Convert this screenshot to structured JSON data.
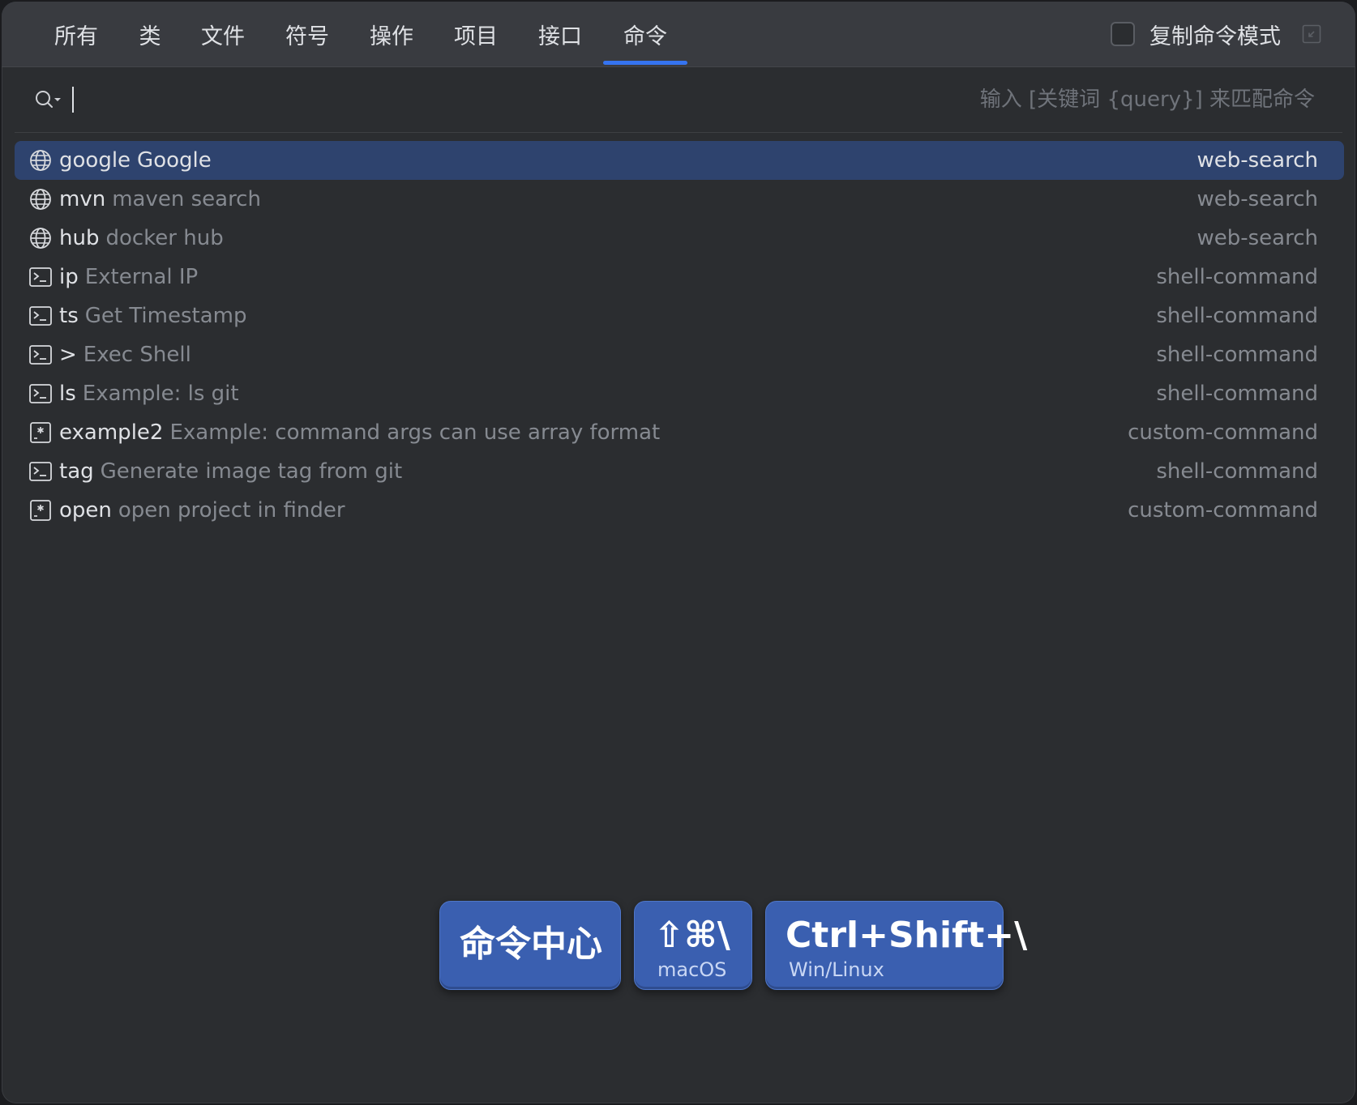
{
  "tabs": [
    {
      "label": "所有"
    },
    {
      "label": "类"
    },
    {
      "label": "文件"
    },
    {
      "label": "符号"
    },
    {
      "label": "操作"
    },
    {
      "label": "项目"
    },
    {
      "label": "接口"
    },
    {
      "label": "命令"
    }
  ],
  "active_tab": "命令",
  "copy_mode": {
    "label": "复制命令模式",
    "checked": false
  },
  "search": {
    "value": "",
    "placeholder": "输入 [关键词 {query}] 来匹配命令"
  },
  "results": [
    {
      "name": "google",
      "desc": "Google",
      "type": "web-search",
      "icon": "globe-icon",
      "selected": true
    },
    {
      "name": "mvn",
      "desc": "maven search",
      "type": "web-search",
      "icon": "globe-icon"
    },
    {
      "name": "hub",
      "desc": "docker hub",
      "type": "web-search",
      "icon": "globe-icon"
    },
    {
      "name": "ip",
      "desc": "External IP",
      "type": "shell-command",
      "icon": "terminal-icon"
    },
    {
      "name": "ts",
      "desc": "Get Timestamp",
      "type": "shell-command",
      "icon": "terminal-icon"
    },
    {
      "name": ">",
      "desc": "Exec Shell",
      "type": "shell-command",
      "icon": "terminal-icon"
    },
    {
      "name": "ls",
      "desc": "Example: ls git",
      "type": "shell-command",
      "icon": "terminal-icon"
    },
    {
      "name": "example2",
      "desc": "Example: command args can use array format",
      "type": "custom-command",
      "icon": "custom-command-icon"
    },
    {
      "name": "tag",
      "desc": "Generate image tag from git",
      "type": "shell-command",
      "icon": "terminal-icon"
    },
    {
      "name": "open",
      "desc": "open project in finder",
      "type": "custom-command",
      "icon": "custom-command-icon"
    }
  ],
  "shortcut_badges": {
    "title": "命令中心",
    "mac": {
      "keys": "⇧⌘\\",
      "os": "macOS"
    },
    "win": {
      "keys": "Ctrl+Shift+\\",
      "os": "Win/Linux"
    }
  },
  "colors": {
    "accent": "#3574f0",
    "selected_row": "#2e436e",
    "badge": "#3a5fb0",
    "background": "#2b2d30",
    "tabbar": "#393b40"
  }
}
